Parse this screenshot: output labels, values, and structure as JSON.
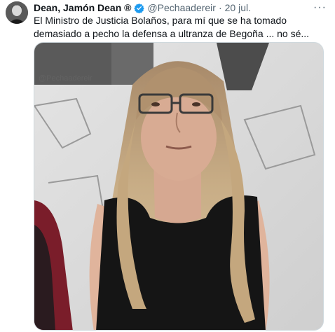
{
  "tweet": {
    "author_name": "Dean, Jamón Dean ®",
    "handle": "@Pechaadereir",
    "separator": "·",
    "date": "20 jul.",
    "more": "···",
    "text": "El Ministro de Justicia Bolaños, para mí que se ha tomado demasiado a pecho la defensa a ultranza de Begoña ... no sé...",
    "media_watermark": "@Pechaadereir",
    "verified_color": "#1d9bf0",
    "more_icon": "more-horizontal-icon",
    "verified_icon": "verified-badge-icon"
  }
}
